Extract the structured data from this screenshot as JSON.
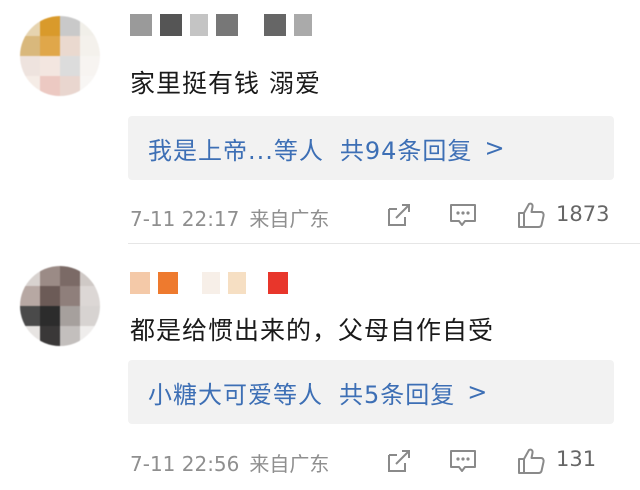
{
  "comments": [
    {
      "text": "家里挺有钱 溺爱",
      "reply_preview": {
        "users": "我是上帝...等人",
        "count": "共94条回复",
        "chevron": ">"
      },
      "time": "7-11 22:17",
      "source": "来自广东",
      "likes": "1873"
    },
    {
      "text": "都是给惯出来的，父母自作自受",
      "reply_preview": {
        "users": "小糖大可爱等人",
        "count": "共5条回复",
        "chevron": ">"
      },
      "time": "7-11 22:56",
      "source": "来自广东",
      "likes": "131"
    }
  ],
  "icons": {
    "share": "share-icon",
    "comment": "comment-icon",
    "like": "thumbs-up-icon"
  },
  "colors": {
    "link": "#3d6fb5",
    "meta": "#8f8f8f",
    "reply_bg": "#f2f2f2"
  }
}
